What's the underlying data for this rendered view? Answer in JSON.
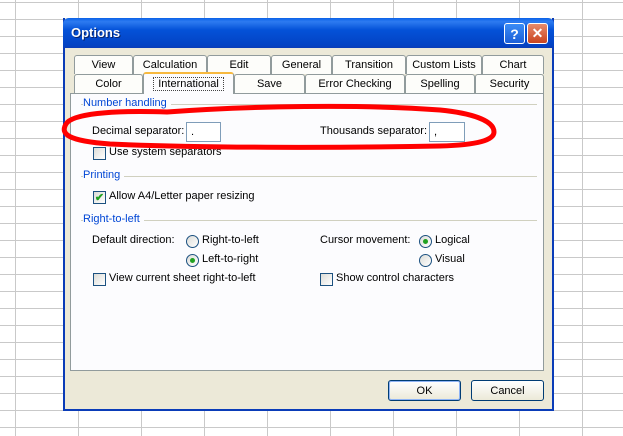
{
  "window": {
    "title": "Options",
    "help_symbol": "?",
    "close_symbol": "✕"
  },
  "tabs_row1": [
    "View",
    "Calculation",
    "Edit",
    "General",
    "Transition",
    "Custom Lists",
    "Chart"
  ],
  "tabs_row2": [
    "Color",
    "International",
    "Save",
    "Error Checking",
    "Spelling",
    "Security"
  ],
  "number_handling": {
    "title": "Number handling",
    "decimal_label": "Decimal separator:",
    "decimal_value": ".",
    "thousands_label": "Thousands separator:",
    "thousands_value": ",",
    "use_system_label": "Use system separators"
  },
  "printing": {
    "title": "Printing",
    "allow_resize_label": "Allow A4/Letter paper resizing"
  },
  "rtl": {
    "title": "Right-to-left",
    "default_direction_label": "Default direction:",
    "opt_rtl": "Right-to-left",
    "opt_ltr": "Left-to-right",
    "cursor_label": "Cursor movement:",
    "opt_logical": "Logical",
    "opt_visual": "Visual",
    "view_sheet_label": "View current sheet right-to-left",
    "show_control_label": "Show control characters"
  },
  "buttons": {
    "ok": "OK",
    "cancel": "Cancel"
  },
  "colors": {
    "titlebar": "#0452d8",
    "group_title": "#0046d5",
    "annotation": "#ff0000"
  }
}
